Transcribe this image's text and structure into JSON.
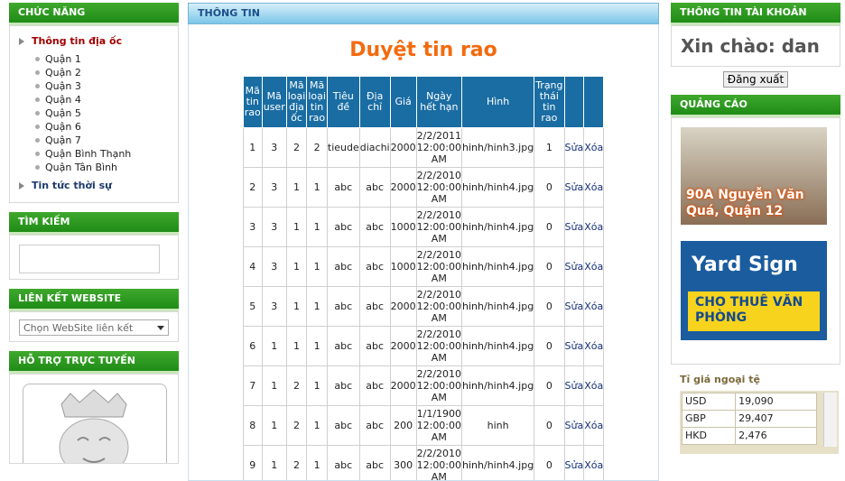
{
  "left": {
    "menu_title": "CHỨC NĂNG",
    "item1": "Thông tin địa ốc",
    "districts": [
      "Quận 1",
      "Quận 2",
      "Quận 3",
      "Quận 4",
      "Quận 5",
      "Quận 6",
      "Quận 7",
      "Quận Bình Thạnh",
      "Quận Tân Bình"
    ],
    "item2": "Tin tức thời sự",
    "search_title": "TÌM KIẾM",
    "links_title": "LIÊN KẾT WEBSITE",
    "links_selected": "Chọn WebSite liên kết",
    "support_title": "HỖ TRỢ TRỰC TUYẾN"
  },
  "center": {
    "panel_title": "THÔNG TIN",
    "heading": "Duyệt tin rao",
    "columns": [
      "Mã tin rao",
      "Mã user",
      "Mã loại địa ốc",
      "Mã loại tin rao",
      "Tiêu đề",
      "Địa chỉ",
      "Giá",
      "Ngày hết hạn",
      "Hình",
      "Trạng thái tin rao",
      "",
      ""
    ],
    "rows": [
      [
        "1",
        "3",
        "2",
        "2",
        "tieude",
        "diachi",
        "2000",
        "2/2/2011 12:00:00 AM",
        "hinh/hinh3.jpg",
        "1",
        "Sửa",
        "Xóa"
      ],
      [
        "2",
        "3",
        "1",
        "1",
        "abc",
        "abc",
        "2000",
        "2/2/2010 12:00:00 AM",
        "hinh/hinh4.jpg",
        "0",
        "Sửa",
        "Xóa"
      ],
      [
        "3",
        "3",
        "1",
        "1",
        "abc",
        "abc",
        "1000",
        "2/2/2010 12:00:00 AM",
        "hinh/hinh4.jpg",
        "0",
        "Sửa",
        "Xóa"
      ],
      [
        "4",
        "3",
        "1",
        "1",
        "abc",
        "abc",
        "1000",
        "2/2/2010 12:00:00 AM",
        "hinh/hinh4.jpg",
        "0",
        "Sửa",
        "Xóa"
      ],
      [
        "5",
        "3",
        "1",
        "1",
        "abc",
        "abc",
        "2000",
        "2/2/2010 12:00:00 AM",
        "hinh/hinh4.jpg",
        "0",
        "Sửa",
        "Xóa"
      ],
      [
        "6",
        "1",
        "1",
        "1",
        "abc",
        "abc",
        "2000",
        "2/2/2010 12:00:00 AM",
        "hinh/hinh4.jpg",
        "0",
        "Sửa",
        "Xóa"
      ],
      [
        "7",
        "1",
        "2",
        "1",
        "abc",
        "abc",
        "2000",
        "2/2/2010 12:00:00 AM",
        "hinh/hinh4.jpg",
        "0",
        "Sửa",
        "Xóa"
      ],
      [
        "8",
        "1",
        "2",
        "1",
        "abc",
        "abc",
        "200",
        "1/1/1900 12:00:00 AM",
        "hinh",
        "0",
        "Sửa",
        "Xóa"
      ],
      [
        "9",
        "1",
        "2",
        "1",
        "abc",
        "abc",
        "300",
        "2/2/2010 12:00:00 AM",
        "hinh/hinh4.jpg",
        "0",
        "Sửa",
        "Xóa"
      ]
    ]
  },
  "right": {
    "account_title": "THÔNG TIN TÀI KHOẢN",
    "greeting": "Xin chào: dan",
    "logout": "Đăng xuất",
    "ads_title": "QUẢNG CÁO",
    "ad1_text": "90A Nguyễn Văn Quá, Quận 12",
    "ad2_title": "Yard Sign",
    "ad2_text": "CHO THUÊ VĂN PHÒNG",
    "fx_title": "Tỉ giá ngoại tệ",
    "fx": [
      [
        "USD",
        "19,090"
      ],
      [
        "GBP",
        "29,407"
      ],
      [
        "HKD",
        "2,476"
      ]
    ]
  }
}
